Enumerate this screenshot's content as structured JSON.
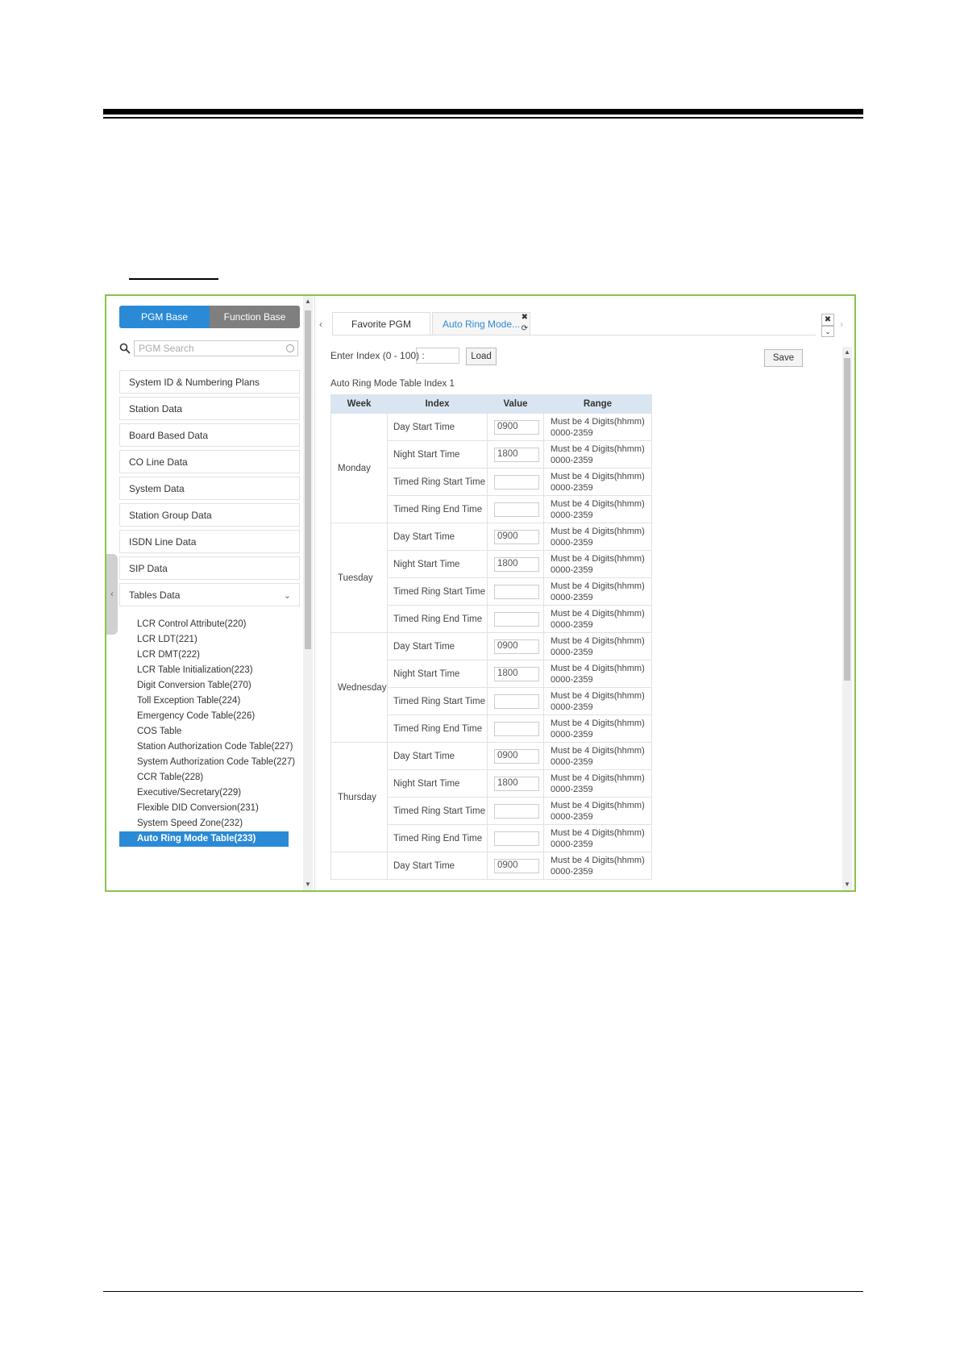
{
  "pgm_tabs": {
    "pgm_base": "PGM Base",
    "function_base": "Function Base"
  },
  "search": {
    "placeholder": "PGM Search"
  },
  "menu": [
    {
      "label": "System ID & Numbering Plans"
    },
    {
      "label": "Station Data"
    },
    {
      "label": "Board Based Data"
    },
    {
      "label": "CO Line Data"
    },
    {
      "label": "System Data"
    },
    {
      "label": "Station Group Data"
    },
    {
      "label": "ISDN Line Data"
    },
    {
      "label": "SIP Data"
    },
    {
      "label": "Tables Data"
    }
  ],
  "submenu": [
    "LCR Control Attribute(220)",
    "LCR LDT(221)",
    "LCR DMT(222)",
    "LCR Table Initialization(223)",
    "Digit Conversion Table(270)",
    "Toll Exception Table(224)",
    "Emergency Code Table(226)",
    "COS Table",
    "Station Authorization Code Table(227)",
    "System Authorization Code Table(227)",
    "CCR Table(228)",
    "Executive/Secretary(229)",
    "Flexible DID Conversion(231)",
    "System Speed Zone(232)",
    "Auto Ring Mode Table(233)"
  ],
  "active_submenu": "Auto Ring Mode Table(233)",
  "tabs": {
    "favorite": "Favorite PGM",
    "auto_ring": "Auto Ring Mode..."
  },
  "index_label": "Enter Index (0 - 100) :",
  "load_label": "Load",
  "save_label": "Save",
  "table_title": "Auto Ring Mode Table Index 1",
  "columns": {
    "week": "Week",
    "index": "Index",
    "value": "Value",
    "range": "Range"
  },
  "range_text": {
    "line1": "Must be 4 Digits(hhmm)",
    "line2": "0000-2359"
  },
  "rows": [
    {
      "week": "Monday",
      "index": "Day Start Time",
      "value": "0900"
    },
    {
      "week": "",
      "index": "Night Start Time",
      "value": "1800"
    },
    {
      "week": "",
      "index": "Timed Ring Start Time",
      "value": ""
    },
    {
      "week": "",
      "index": "Timed Ring End Time",
      "value": ""
    },
    {
      "week": "Tuesday",
      "index": "Day Start Time",
      "value": "0900"
    },
    {
      "week": "",
      "index": "Night Start Time",
      "value": "1800"
    },
    {
      "week": "",
      "index": "Timed Ring Start Time",
      "value": ""
    },
    {
      "week": "",
      "index": "Timed Ring End Time",
      "value": ""
    },
    {
      "week": "Wednesday",
      "index": "Day Start Time",
      "value": "0900"
    },
    {
      "week": "",
      "index": "Night Start Time",
      "value": "1800"
    },
    {
      "week": "",
      "index": "Timed Ring Start Time",
      "value": ""
    },
    {
      "week": "",
      "index": "Timed Ring End Time",
      "value": ""
    },
    {
      "week": "Thursday",
      "index": "Day Start Time",
      "value": "0900"
    },
    {
      "week": "",
      "index": "Night Start Time",
      "value": "1800"
    },
    {
      "week": "",
      "index": "Timed Ring Start Time",
      "value": ""
    },
    {
      "week": "",
      "index": "Timed Ring End Time",
      "value": ""
    },
    {
      "week": "",
      "index": "Day Start Time",
      "value": "0900"
    }
  ],
  "colors": {
    "accent": "#2b8ad6",
    "frame_border": "#8bc34a",
    "header_bg": "#d9e6f2"
  }
}
